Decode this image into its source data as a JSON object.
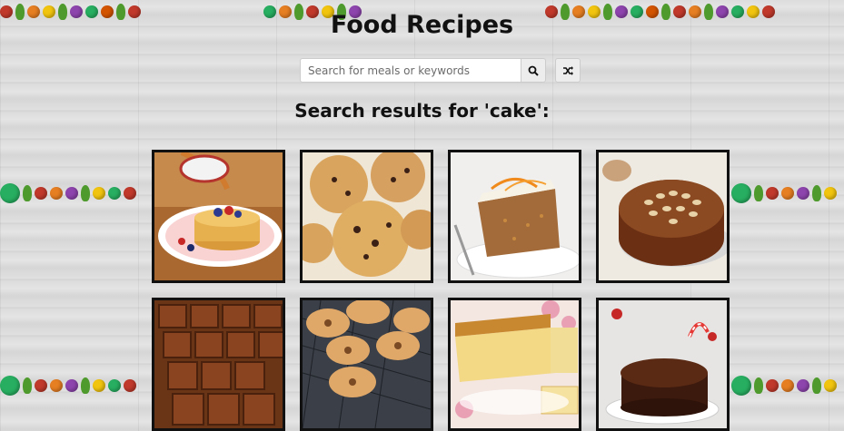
{
  "header": {
    "title": "Food Recipes"
  },
  "search": {
    "placeholder": "Search for meals or keywords",
    "value": "",
    "search_icon": "search-icon",
    "random_icon": "shuffle-icon"
  },
  "results": {
    "heading": "Search results for 'cake':",
    "meals": [
      {
        "image": "pancakes"
      },
      {
        "image": "scones"
      },
      {
        "image": "carrot-cake"
      },
      {
        "image": "dundee-cake"
      },
      {
        "image": "brownies"
      },
      {
        "image": "doughnuts"
      },
      {
        "image": "pound-cake"
      },
      {
        "image": "christmas-cake"
      }
    ]
  },
  "colors": {
    "background": "#dcdcdc",
    "card_border": "#111111",
    "button_bg": "#ededed"
  }
}
